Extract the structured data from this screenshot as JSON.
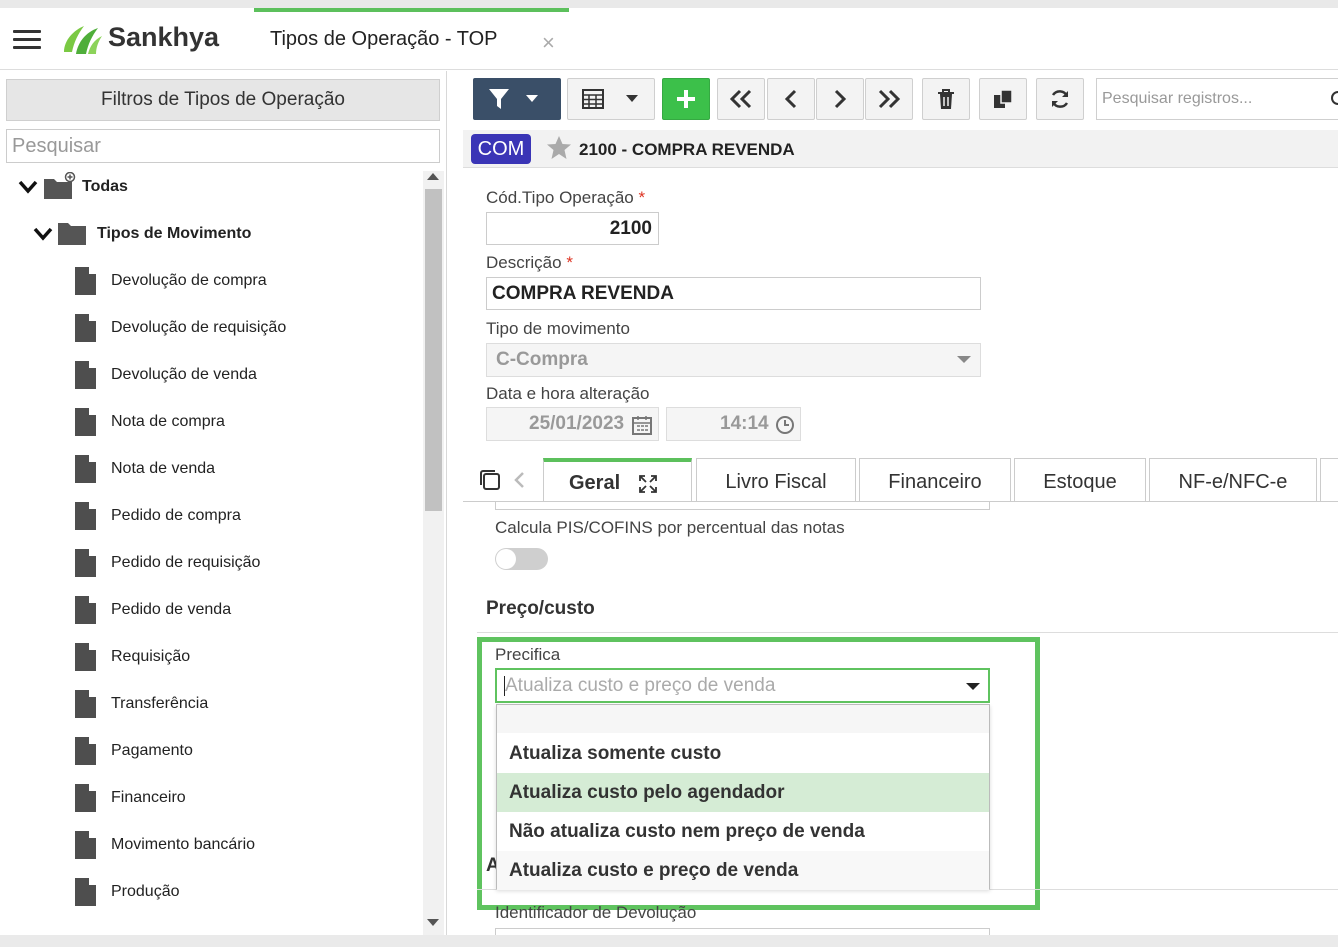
{
  "app": {
    "brand": "Sankhya",
    "tab_title": "Tipos de Operação - TOP",
    "tab_close": "×"
  },
  "sidebar": {
    "filters_title": "Filtros de Tipos de Operação",
    "search_placeholder": "Pesquisar",
    "root_label": "Todas",
    "group_label": "Tipos de Movimento",
    "items": [
      "Devolução de compra",
      "Devolução de requisição",
      "Devolução de venda",
      "Nota de compra",
      "Nota de venda",
      "Pedido de compra",
      "Pedido de requisição",
      "Pedido de venda",
      "Requisição",
      "Transferência",
      "Pagamento",
      "Financeiro",
      "Movimento bancário",
      "Produção"
    ]
  },
  "toolbar": {
    "search_placeholder": "Pesquisar registros..."
  },
  "record": {
    "badge": "COM",
    "title": "2100 - COMPRA REVENDA"
  },
  "form": {
    "cod_label": "Cód.Tipo Operação",
    "cod_value": "2100",
    "desc_label": "Descrição",
    "desc_value": "COMPRA REVENDA",
    "tipo_label": "Tipo de movimento",
    "tipo_value": "C-Compra",
    "data_label": "Data e hora alteração",
    "date_value": "25/01/2023",
    "time_value": "14:14",
    "required_mark": "*"
  },
  "tabs": [
    {
      "label": "Geral",
      "active": true
    },
    {
      "label": "Livro Fiscal"
    },
    {
      "label": "Financeiro"
    },
    {
      "label": "Estoque"
    },
    {
      "label": "NF-e/NFC-e"
    }
  ],
  "geral": {
    "pis_label": "Calcula PIS/COFINS por percentual das notas",
    "pis_on": false,
    "section_title": "Preço/custo",
    "precifica_label": "Precifica",
    "precifica_value": "Atualiza custo e preço de venda",
    "options": [
      "",
      "Atualiza somente custo",
      "Atualiza custo pelo agendador",
      "Não atualiza custo nem preço de venda",
      "Atualiza custo e preço de venda"
    ],
    "hovered_option_index": 2,
    "partial_letter": "A",
    "next_field_label": "Identificador de Devolução"
  },
  "colors": {
    "accent_green": "#5cc05c",
    "badge_blue": "#3a35b6",
    "hover_green": "#d5ecd5",
    "required_red": "#d32f2f"
  }
}
